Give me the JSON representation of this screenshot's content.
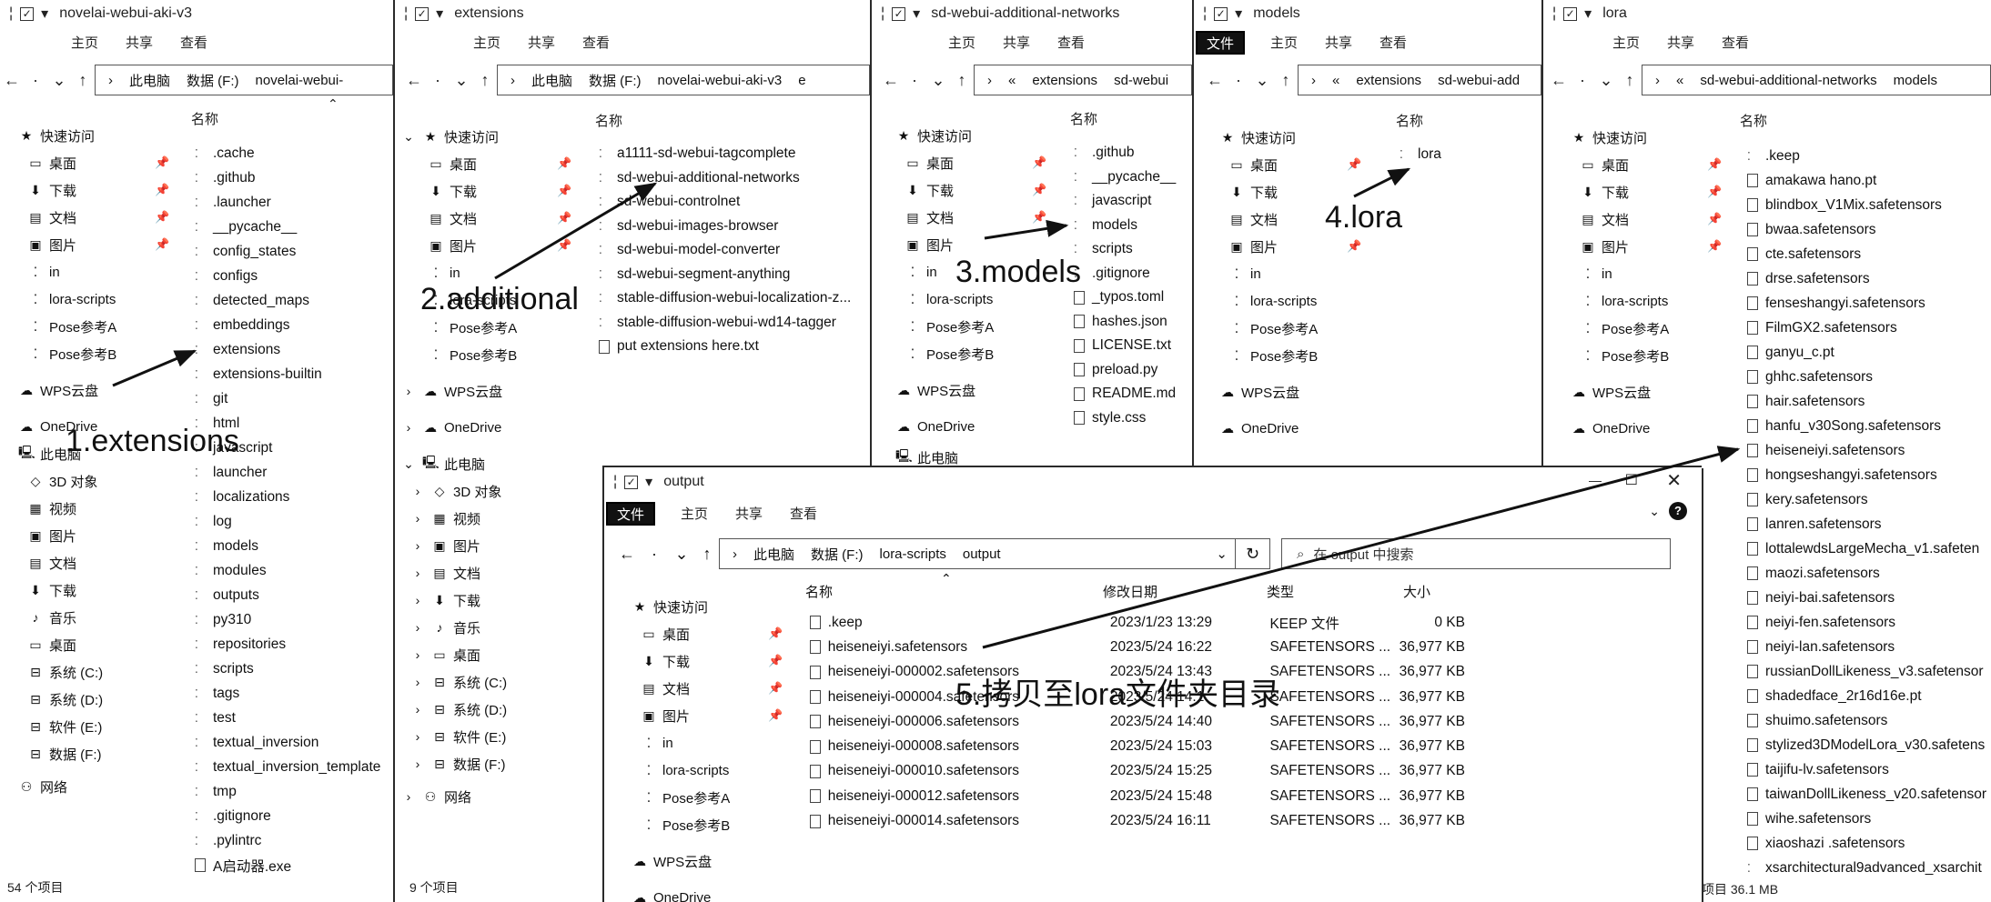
{
  "ribbon": {
    "file": "文件",
    "home": "主页",
    "share": "共享",
    "view": "查看"
  },
  "sidebar_labels": {
    "quick": "快速访问",
    "desktop": "桌面",
    "downloads": "下载",
    "docs": "文档",
    "pictures": "图片",
    "in": "in",
    "lora_scripts": "lora-scripts",
    "poseA": "Pose参考A",
    "poseB": "Pose参考B",
    "wps": "WPS云盘",
    "onedrive": "OneDrive",
    "thispc": "此电脑",
    "obj3d": "3D 对象",
    "videos": "视频",
    "music": "音乐",
    "sysC": "系统 (C:)",
    "sysD": "系统 (D:)",
    "softE": "软件 (E:)",
    "dataF": "数据 (F:)",
    "network": "网络"
  },
  "col_name": "名称",
  "w1": {
    "title": "novelai-webui-aki-v3",
    "path": [
      "此电脑",
      "数据 (F:)",
      "novelai-webui-"
    ],
    "items": [
      ".cache",
      ".github",
      ".launcher",
      "__pycache__",
      "config_states",
      "configs",
      "detected_maps",
      "embeddings",
      "extensions",
      "extensions-builtin",
      "git",
      "html",
      "javascript",
      "launcher",
      "localizations",
      "log",
      "models",
      "modules",
      "outputs",
      "py310",
      "repositories",
      "scripts",
      "tags",
      "test",
      "textual_inversion",
      "textual_inversion_template",
      "tmp",
      ".gitignore",
      ".pylintrc",
      "A启动器.exe"
    ],
    "status": "54 个项目"
  },
  "w2": {
    "title": "extensions",
    "path": [
      "此电脑",
      "数据 (F:)",
      "novelai-webui-aki-v3",
      "e"
    ],
    "items": [
      "a1111-sd-webui-tagcomplete",
      "sd-webui-additional-networks",
      "sd-webui-controlnet",
      "sd-webui-images-browser",
      "sd-webui-model-converter",
      "sd-webui-segment-anything",
      "stable-diffusion-webui-localization-z...",
      "stable-diffusion-webui-wd14-tagger",
      "put extensions here.txt"
    ],
    "status": "9 个项目"
  },
  "w3": {
    "title": "sd-webui-additional-networks",
    "path": [
      "«",
      "extensions",
      "sd-webui"
    ],
    "items": [
      ".github",
      "__pycache__",
      "javascript",
      "models",
      "scripts",
      ".gitignore",
      "_typos.toml",
      "hashes.json",
      "LICENSE.txt",
      "preload.py",
      "README.md",
      "style.css"
    ],
    "sidebar_partial": "此电脑"
  },
  "w4": {
    "title": "models",
    "path": [
      "«",
      "extensions",
      "sd-webui-add"
    ],
    "items": [
      "lora"
    ]
  },
  "w5": {
    "title": "lora",
    "path": [
      "«",
      "sd-webui-additional-networks",
      "models"
    ],
    "items": [
      ".keep",
      "amakawa hano.pt",
      "blindbox_V1Mix.safetensors",
      "bwaa.safetensors",
      "cte.safetensors",
      "drse.safetensors",
      "fenseshangyi.safetensors",
      "FilmGX2.safetensors",
      "ganyu_c.pt",
      "ghhc.safetensors",
      "hair.safetensors",
      "hanfu_v30Song.safetensors",
      "heiseneiyi.safetensors",
      "hongseshangyi.safetensors",
      "kery.safetensors",
      "lanren.safetensors",
      "lottalewdsLargeMecha_v1.safeten",
      "maozi.safetensors",
      "neiyi-bai.safetensors",
      "neiyi-fen.safetensors",
      "neiyi-lan.safetensors",
      "russianDollLikeness_v3.safetensor",
      "shadedface_2r16d16e.pt",
      "shuimo.safetensors",
      "stylized3DModelLora_v30.safetens",
      "taijifu-lv.safetensors",
      "taiwanDollLikeness_v20.safetensor",
      "wihe.safetensors",
      "xiaoshazi .safetensors",
      "xsarchitectural9advanced_xsarchit"
    ],
    "status": "项目   36.1 MB"
  },
  "w6": {
    "title": "output",
    "path": [
      "此电脑",
      "数据 (F:)",
      "lora-scripts",
      "output"
    ],
    "search": "在 output 中搜索",
    "headers": {
      "name": "名称",
      "date": "修改日期",
      "type": "类型",
      "size": "大小"
    },
    "rows": [
      {
        "name": ".keep",
        "date": "2023/1/23 13:29",
        "type": "KEEP 文件",
        "size": "0 KB"
      },
      {
        "name": "heiseneiyi.safetensors",
        "date": "2023/5/24 16:22",
        "type": "SAFETENSORS ...",
        "size": "36,977 KB"
      },
      {
        "name": "heiseneiyi-000002.safetensors",
        "date": "2023/5/24 13:43",
        "type": "SAFETENSORS ...",
        "size": "36,977 KB"
      },
      {
        "name": "heiseneiyi-000004.safetensors",
        "date": "2023/5/24 14:1",
        "type": "SAFETENSORS ...",
        "size": "36,977 KB"
      },
      {
        "name": "heiseneiyi-000006.safetensors",
        "date": "2023/5/24 14:40",
        "type": "SAFETENSORS ...",
        "size": "36,977 KB"
      },
      {
        "name": "heiseneiyi-000008.safetensors",
        "date": "2023/5/24 15:03",
        "type": "SAFETENSORS ...",
        "size": "36,977 KB"
      },
      {
        "name": "heiseneiyi-000010.safetensors",
        "date": "2023/5/24 15:25",
        "type": "SAFETENSORS ...",
        "size": "36,977 KB"
      },
      {
        "name": "heiseneiyi-000012.safetensors",
        "date": "2023/5/24 15:48",
        "type": "SAFETENSORS ...",
        "size": "36,977 KB"
      },
      {
        "name": "heiseneiyi-000014.safetensors",
        "date": "2023/5/24 16:11",
        "type": "SAFETENSORS ...",
        "size": "36,977 KB"
      }
    ]
  },
  "annotations": {
    "a1": "1.extensions",
    "a2": "2.additional",
    "a3": "3.models",
    "a4": "4.lora",
    "a5": "5.拷贝至lora文件夹目录"
  }
}
